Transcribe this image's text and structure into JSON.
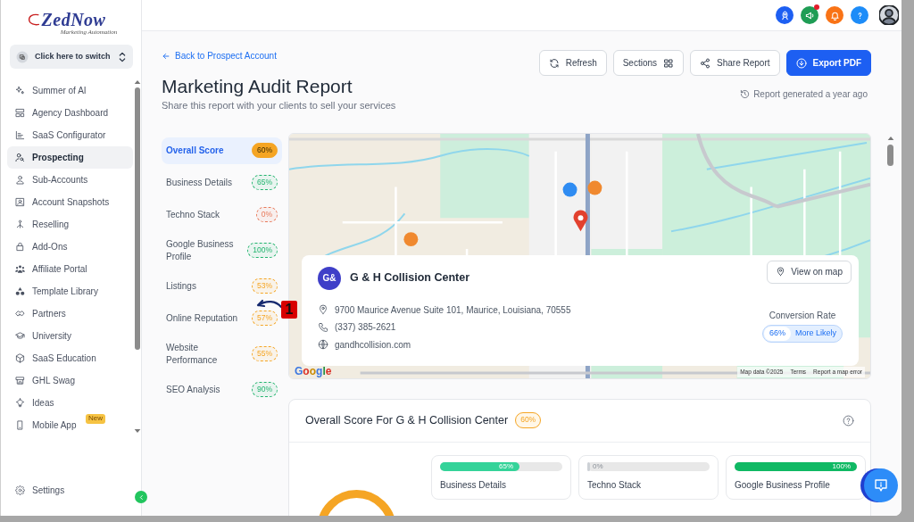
{
  "sidebar": {
    "logo": {
      "title": "ZedNow",
      "tagline": "Marketing Automation"
    },
    "switcher": {
      "label": "Click here to switch"
    },
    "items": [
      {
        "label": "Summer of AI",
        "selected": false
      },
      {
        "label": "Agency Dashboard",
        "selected": false
      },
      {
        "label": "SaaS Configurator",
        "selected": false
      },
      {
        "label": "Prospecting",
        "selected": true
      },
      {
        "label": "Sub-Accounts",
        "selected": false
      },
      {
        "label": "Account Snapshots",
        "selected": false
      },
      {
        "label": "Reselling",
        "selected": false
      },
      {
        "label": "Add-Ons",
        "selected": false
      },
      {
        "label": "Affiliate Portal",
        "selected": false
      },
      {
        "label": "Template Library",
        "selected": false
      },
      {
        "label": "Partners",
        "selected": false
      },
      {
        "label": "University",
        "selected": false
      },
      {
        "label": "SaaS Education",
        "selected": false
      },
      {
        "label": "GHL Swag",
        "selected": false
      },
      {
        "label": "Ideas",
        "selected": false
      },
      {
        "label": "Mobile App",
        "selected": false,
        "badge": "New"
      }
    ],
    "settings": {
      "label": "Settings"
    }
  },
  "header": {
    "buttons": [
      {
        "dot": false
      },
      {
        "dot": true
      },
      {
        "dot": false
      },
      {
        "dot": false
      }
    ]
  },
  "page": {
    "back_link": "Back to Prospect Account",
    "title": "Marketing Audit Report",
    "subtitle": "Share this report with your clients to sell your services",
    "actions": [
      {
        "label": "Refresh",
        "kind": "outline"
      },
      {
        "label": "Sections",
        "kind": "outline"
      },
      {
        "label": "Share Report",
        "kind": "outline"
      },
      {
        "label": "Export PDF",
        "kind": "primary"
      }
    ],
    "generated": "Report generated a year ago"
  },
  "score_nav": [
    {
      "label": "Overall Score",
      "score": "60%",
      "color": "#f5a524",
      "selected": true
    },
    {
      "label": "Business Details",
      "score": "65%",
      "color": "#22b46e",
      "selected": false
    },
    {
      "label": "Techno Stack",
      "score": "0%",
      "color": "#e8795a",
      "selected": false
    },
    {
      "label": "Google Business Profile",
      "score": "100%",
      "color": "#22b46e",
      "selected": false
    },
    {
      "label": "Listings",
      "score": "53%",
      "color": "#f5a524",
      "selected": false
    },
    {
      "label": "Online Reputation",
      "score": "57%",
      "color": "#f5a524",
      "selected": false
    },
    {
      "label": "Website Performance",
      "score": "55%",
      "color": "#f5a524",
      "selected": false
    },
    {
      "label": "SEO Analysis",
      "score": "90%",
      "color": "#22b46e",
      "selected": false
    }
  ],
  "map": {
    "logo": "Google",
    "attribution": [
      "Map data ©2025",
      "Terms",
      "Report a map error"
    ]
  },
  "business": {
    "initials": "G&",
    "name": "G & H Collision Center",
    "address": "9700 Maurice Avenue Suite 101, Maurice, Louisiana, 70555",
    "phone": "(337) 385-2621",
    "website": "gandhcollision.com",
    "view_button": "View on map",
    "conversion": {
      "label": "Conversion Rate",
      "value": "66%",
      "text": "More Likely"
    }
  },
  "overall": {
    "title": "Overall Score For G & H Collision Center",
    "score": "60%",
    "categories": [
      {
        "label": "Business Details",
        "reading": "65%",
        "level": 0.65,
        "color": "#34d399"
      },
      {
        "label": "Techno Stack",
        "reading": "0%",
        "level": 0
      },
      {
        "label": "Google Business Profile",
        "reading": "100%",
        "level": 1,
        "color": "#10b964"
      }
    ]
  },
  "annotation": {
    "label": "1"
  }
}
